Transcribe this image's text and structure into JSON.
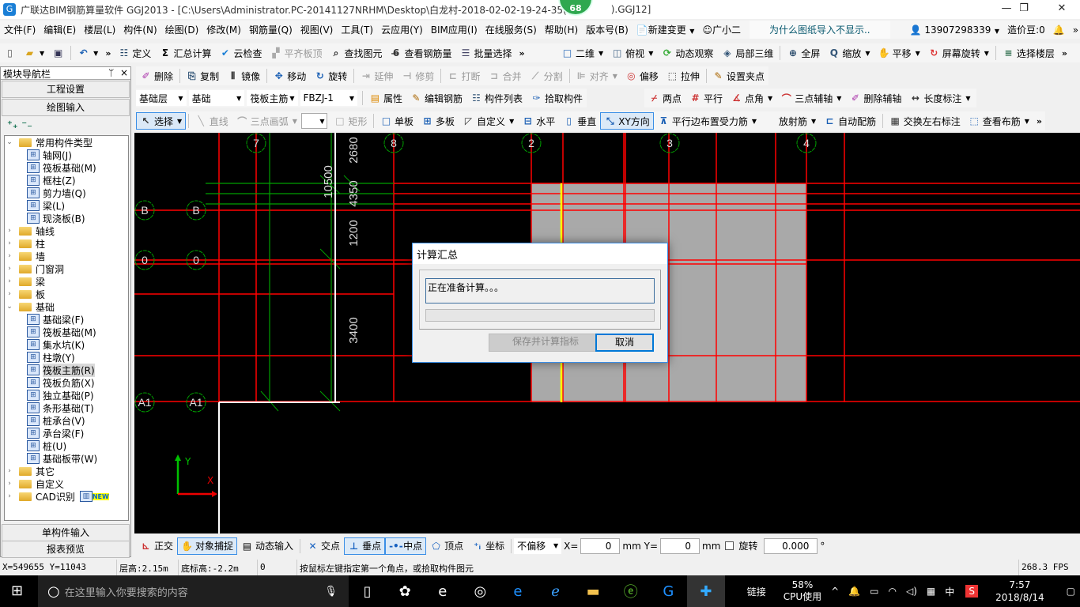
{
  "window": {
    "title_prefix": "广联达BIM钢筋算量软件 GGJ2013 - [C:\\Users\\Administrator.PC-20141127NRHM\\Desktop\\白龙村-2018-02-02-19-24-35(",
    "title_suffix": ").GGJ12]",
    "badge": "68"
  },
  "menu": [
    "文件(F)",
    "编辑(E)",
    "楼层(L)",
    "构件(N)",
    "绘图(D)",
    "修改(M)",
    "钢筋量(Q)",
    "视图(V)",
    "工具(T)",
    "云应用(Y)",
    "BIM应用(I)",
    "在线服务(S)",
    "帮助(H)",
    "版本号(B)"
  ],
  "menu_extras": {
    "new_change": "新建变更",
    "assistant": "广小二",
    "notice": "为什么图纸导入不显示..",
    "user": "13907298339",
    "beans": "造价豆:0"
  },
  "toolbar1": [
    {
      "icon": "new-file-icon",
      "label": ""
    },
    {
      "icon": "open-folder-icon",
      "label": "",
      "dropdown": true
    },
    {
      "icon": "save-icon",
      "label": ""
    },
    {
      "sep": true
    },
    {
      "icon": "undo-icon",
      "label": "",
      "dropdown": true
    },
    {
      "more": true
    },
    {
      "icon": "define-icon",
      "label": "定义"
    },
    {
      "icon": "sum-calc-icon",
      "label": "汇总计算"
    },
    {
      "icon": "cloud-check-icon",
      "label": "云检查"
    },
    {
      "icon": "align-slab-top-icon",
      "label": "平齐板顶",
      "disabled": true
    },
    {
      "icon": "find-element-icon",
      "label": "查找图元"
    },
    {
      "icon": "view-rebar-icon",
      "label": "查看钢筋量"
    },
    {
      "icon": "batch-select-icon",
      "label": "批量选择"
    },
    {
      "more": true
    }
  ],
  "toolbar1b": [
    {
      "icon": "2d-view-icon",
      "label": "二维",
      "dropdown": true
    },
    {
      "icon": "top-view-icon",
      "label": "俯视",
      "dropdown": true
    },
    {
      "icon": "dynamic-observe-icon",
      "label": "动态观察"
    },
    {
      "icon": "local-3d-icon",
      "label": "局部三维"
    },
    {
      "sep": true
    },
    {
      "icon": "fullscreen-icon",
      "label": "全屏"
    },
    {
      "icon": "zoom-icon",
      "label": "缩放",
      "dropdown": true
    },
    {
      "icon": "pan-icon",
      "label": "平移",
      "dropdown": true
    },
    {
      "icon": "screen-rotate-icon",
      "label": "屏幕旋转",
      "dropdown": true
    },
    {
      "sep": true
    },
    {
      "icon": "select-floor-icon",
      "label": "选择楼层"
    },
    {
      "more": true
    }
  ],
  "toolbar2": [
    {
      "icon": "delete-icon",
      "label": "删除"
    },
    {
      "sep": true
    },
    {
      "icon": "copy-icon",
      "label": "复制"
    },
    {
      "icon": "mirror-icon",
      "label": "镜像"
    },
    {
      "sep": true
    },
    {
      "icon": "move-icon",
      "label": "移动"
    },
    {
      "icon": "rotate-icon",
      "label": "旋转"
    },
    {
      "sep": true
    },
    {
      "icon": "extend-icon",
      "label": "延伸",
      "disabled": true
    },
    {
      "icon": "trim-icon",
      "label": "修剪",
      "disabled": true
    },
    {
      "sep": true
    },
    {
      "icon": "break-icon",
      "label": "打断",
      "disabled": true
    },
    {
      "icon": "merge-icon",
      "label": "合并",
      "disabled": true
    },
    {
      "icon": "split-icon",
      "label": "分割",
      "disabled": true
    },
    {
      "sep": true
    },
    {
      "icon": "align-icon",
      "label": "对齐",
      "dropdown": true,
      "disabled": true
    },
    {
      "icon": "offset-icon",
      "label": "偏移"
    },
    {
      "icon": "stretch-icon",
      "label": "拉伸"
    },
    {
      "sep": true
    },
    {
      "icon": "grip-point-icon",
      "label": "设置夹点"
    }
  ],
  "selectors": [
    {
      "value": "基础层"
    },
    {
      "value": "基础"
    },
    {
      "value": "筏板主筋"
    },
    {
      "value": "FBZJ-1"
    }
  ],
  "toolbar3": [
    {
      "icon": "properties-icon",
      "label": "属性"
    },
    {
      "icon": "edit-rebar-icon",
      "label": "编辑钢筋"
    },
    {
      "icon": "component-list-icon",
      "label": "构件列表"
    },
    {
      "icon": "pick-component-icon",
      "label": "拾取构件"
    }
  ],
  "toolbar3b": [
    {
      "icon": "two-point-icon",
      "label": "两点"
    },
    {
      "icon": "parallel-icon",
      "label": "平行"
    },
    {
      "icon": "point-angle-icon",
      "label": "点角",
      "dropdown": true
    },
    {
      "icon": "three-point-axis-icon",
      "label": "三点辅轴",
      "dropdown": true
    },
    {
      "icon": "delete-aux-axis-icon",
      "label": "删除辅轴"
    },
    {
      "icon": "length-dimension-icon",
      "label": "长度标注",
      "dropdown": true
    }
  ],
  "toolbar4a": [
    {
      "icon": "select-icon",
      "label": "选择",
      "dropdown": true,
      "active": true
    },
    {
      "sep": true
    },
    {
      "icon": "line-icon",
      "label": "直线",
      "disabled": true
    },
    {
      "icon": "arc-icon",
      "label": "三点画弧",
      "dropdown": true,
      "disabled": true
    },
    {
      "combo": true,
      "value": ""
    },
    {
      "icon": "rectangle-icon",
      "label": "矩形",
      "disabled": true
    },
    {
      "sep": true
    },
    {
      "icon": "single-slab-icon",
      "label": "单板"
    },
    {
      "icon": "multi-slab-icon",
      "label": "多板"
    },
    {
      "icon": "custom-icon",
      "label": "自定义",
      "dropdown": true
    },
    {
      "icon": "horizontal-icon",
      "label": "水平"
    },
    {
      "icon": "vertical-icon",
      "label": "垂直"
    },
    {
      "icon": "xy-direction-icon",
      "label": "XY方向",
      "active": true
    },
    {
      "icon": "parallel-edge-rebar-icon",
      "label": "平行边布置受力筋",
      "dropdown": true
    },
    {
      "icon": "radial-rebar-icon",
      "label": "放射筋",
      "dropdown": true
    },
    {
      "icon": "auto-rebar-icon",
      "label": "自动配筋"
    },
    {
      "sep": true
    },
    {
      "icon": "swap-labels-icon",
      "label": "交换左右标注"
    },
    {
      "icon": "view-layout-icon",
      "label": "查看布筋",
      "dropdown": true
    },
    {
      "more": true
    }
  ],
  "nav": {
    "title": "模块导航栏",
    "pin": "ᛘ",
    "close": "×",
    "project_settings": "工程设置",
    "drawing_input": "绘图输入",
    "single_input": "单构件输入",
    "report_preview": "报表预览",
    "tree": [
      {
        "label": "常用构件类型",
        "expanded": true,
        "children": [
          "轴网(J)",
          "筏板基础(M)",
          "框柱(Z)",
          "剪力墙(Q)",
          "梁(L)",
          "现浇板(B)"
        ]
      },
      {
        "label": "轴线"
      },
      {
        "label": "柱"
      },
      {
        "label": "墙"
      },
      {
        "label": "门窗洞"
      },
      {
        "label": "梁"
      },
      {
        "label": "板"
      },
      {
        "label": "基础",
        "expanded": true,
        "children": [
          "基础梁(F)",
          "筏板基础(M)",
          "集水坑(K)",
          "柱墩(Y)",
          "筏板主筋(R)",
          "筏板负筋(X)",
          "独立基础(P)",
          "条形基础(T)",
          "桩承台(V)",
          "承台梁(F)",
          "桩(U)",
          "基础板带(W)"
        ],
        "selected": "筏板主筋(R)"
      },
      {
        "label": "其它"
      },
      {
        "label": "自定义"
      },
      {
        "label": "CAD识别",
        "badge": "NEW"
      }
    ]
  },
  "canvas": {
    "axis_top": [
      "7",
      "8",
      "2",
      "3",
      "4"
    ],
    "axis_left": [
      "B",
      "B",
      "0",
      "0",
      "A1",
      "A1"
    ],
    "dimensions": [
      "2680",
      "10500",
      "4350",
      "1200",
      "3400"
    ],
    "ucs": {
      "x": "X",
      "y": "Y"
    },
    "colors": {
      "axis": "#ff0000",
      "bubble": "#00a000",
      "slab": "#a9a9a9",
      "highlight": "#ffff00",
      "white": "#ffffff"
    }
  },
  "dialog": {
    "title": "计算汇总",
    "message": "正在准备计算。。。",
    "progress": 0,
    "save_button": "保存并计算指标",
    "cancel_button": "取消"
  },
  "bottom_toolbar": {
    "ortho": "正交",
    "snap": "对象捕捉",
    "dynamic_input": "动态输入",
    "intersection": "交点",
    "perpendicular": "垂点",
    "midpoint": "中点",
    "vertex": "顶点",
    "coordinate": "坐标",
    "offset_mode": "不偏移",
    "x_label": "X=",
    "x_value": "0",
    "y_label": "Y=",
    "y_value": "0",
    "unit": "mm",
    "rotate_label": "旋转",
    "rotate_value": "0.000",
    "degree": "°"
  },
  "status": {
    "coords": "X=549655 Y=11043",
    "floor_height": "层高:2.15m",
    "base_elev": "底标高:-2.2m",
    "count": "0",
    "hint": "按鼠标左键指定第一个角点，或拾取构件图元",
    "fps": "268.3 FPS"
  },
  "taskbar": {
    "search_placeholder": "在这里输入你要搜索的内容",
    "link": "链接",
    "cpu_percent": "58%",
    "cpu_label": "CPU使用",
    "ime": "中",
    "time": "7:57",
    "date": "2018/8/14"
  }
}
